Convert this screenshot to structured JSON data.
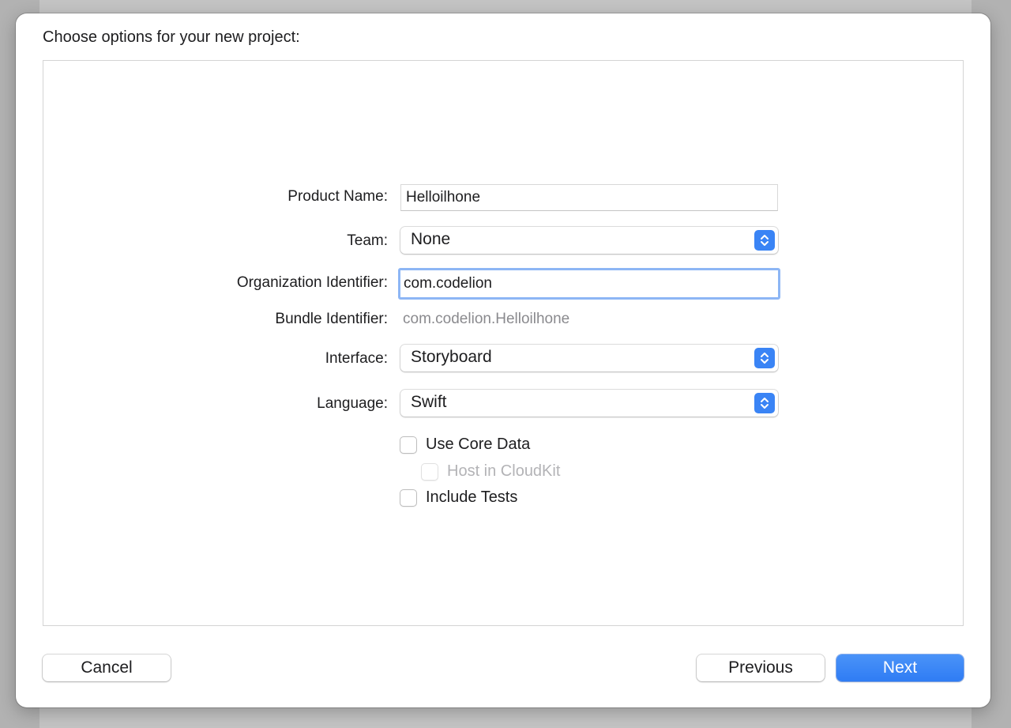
{
  "dialog": {
    "title": "Choose options for your new project:"
  },
  "form": {
    "product_name": {
      "label": "Product Name:",
      "value": "Helloilhone"
    },
    "team": {
      "label": "Team:",
      "value": "None"
    },
    "organization_identifier": {
      "label": "Organization Identifier:",
      "value": "com.codelion"
    },
    "bundle_identifier": {
      "label": "Bundle Identifier:",
      "value": "com.codelion.Helloilhone"
    },
    "interface": {
      "label": "Interface:",
      "value": "Storyboard"
    },
    "language": {
      "label": "Language:",
      "value": "Swift"
    },
    "use_core_data": {
      "label": "Use Core Data",
      "checked": false
    },
    "host_in_cloudkit": {
      "label": "Host in CloudKit",
      "checked": false,
      "disabled": true
    },
    "include_tests": {
      "label": "Include Tests",
      "checked": false
    }
  },
  "buttons": {
    "cancel": "Cancel",
    "previous": "Previous",
    "next": "Next"
  },
  "colors": {
    "accent": "#3a84f5",
    "focus_ring": "#8db6f5",
    "secondary_text": "#8a8a8e",
    "disabled_text": "#b3b3b6"
  },
  "icons": {
    "popup_stepper": "chevron-up-down-icon"
  }
}
